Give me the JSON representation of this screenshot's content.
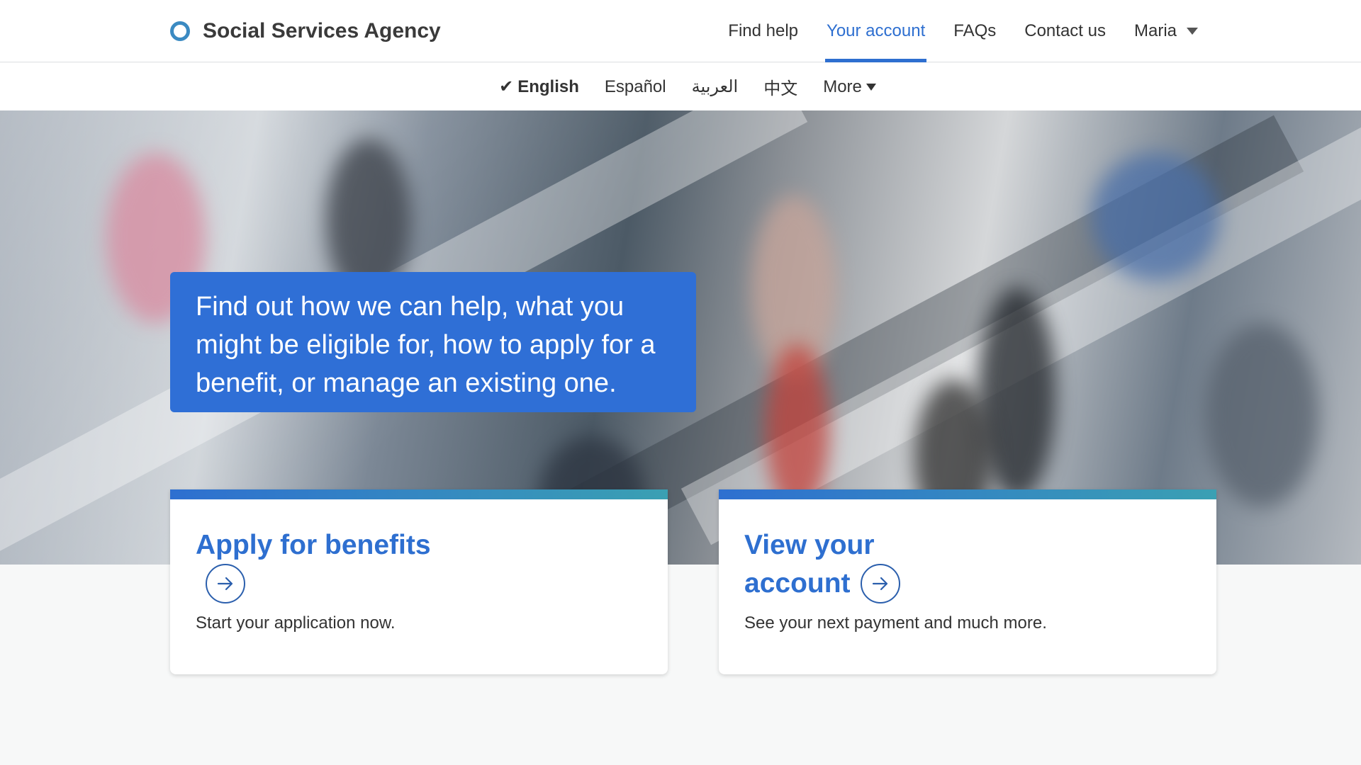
{
  "header": {
    "brand_name": "Social Services Agency",
    "nav": [
      {
        "label": "Find help",
        "active": false
      },
      {
        "label": "Your account",
        "active": true
      },
      {
        "label": "FAQs",
        "active": false
      },
      {
        "label": "Contact us",
        "active": false
      }
    ],
    "user_name": "Maria"
  },
  "languages": {
    "items": [
      "English",
      "Español",
      "العربية",
      "中文"
    ],
    "selected": "English",
    "more_label": "More"
  },
  "hero": {
    "callout": "Find out how we can help, what you might be eligible for, how to apply for a benefit, or manage an existing one."
  },
  "cards": [
    {
      "title": "Apply for benefits",
      "description": "Start your application now."
    },
    {
      "title": "View your account",
      "description": "See your next payment and much more."
    }
  ],
  "colors": {
    "accent": "#2e6fd0",
    "callout_bg": "#2f6fd6",
    "logo_ring": "#3b8ac2",
    "card_bar_end": "#3aa0b3"
  },
  "icons": {
    "logo": "circle-ring-icon",
    "user_menu": "caret-down-icon",
    "card_link": "arrow-right-circle-icon"
  }
}
